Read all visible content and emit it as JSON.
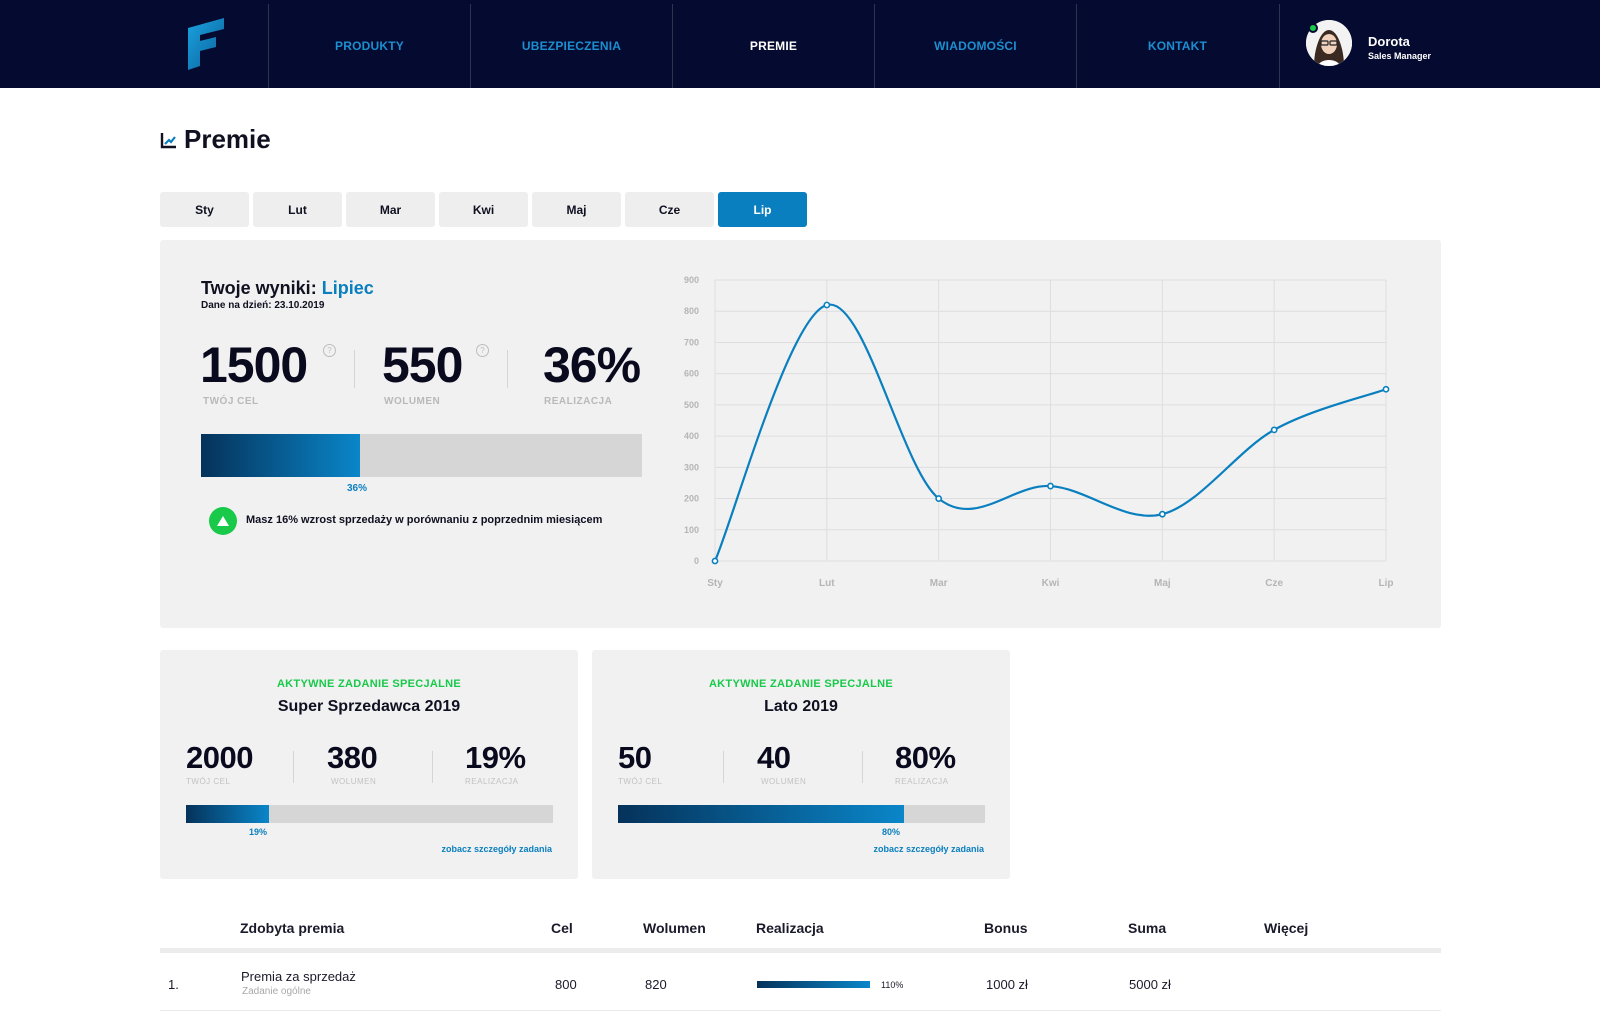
{
  "nav": {
    "items": [
      {
        "label": "PRODUKTY",
        "active": false
      },
      {
        "label": "UBEZPIECZENIA",
        "active": false
      },
      {
        "label": "PREMIE",
        "active": true
      },
      {
        "label": "WIADOMOŚCI",
        "active": false
      },
      {
        "label": "KONTAKT",
        "active": false
      }
    ],
    "user": {
      "name": "Dorota",
      "role": "Sales Manager",
      "online": true
    }
  },
  "page": {
    "title": "Premie",
    "icon": "chart-line-icon"
  },
  "months": {
    "tabs": [
      "Sty",
      "Lut",
      "Mar",
      "Kwi",
      "Maj",
      "Cze",
      "Lip"
    ],
    "selected": "Lip"
  },
  "results": {
    "title_prefix": "Twoje wyniki:",
    "month": "Lipiec",
    "date_text": "Dane na dzień: 23.10.2019",
    "target": {
      "value": "1500",
      "label": "TWÓJ CEL"
    },
    "volume": {
      "value": "550",
      "label": "WOLUMEN"
    },
    "realization": {
      "value": "36%",
      "label": "REALIZACJA"
    },
    "progress_label": "36%",
    "progress_fraction": 0.36,
    "trend_text": "Masz 16% wzrost sprzedaży w porównaniu z poprzednim miesiącem",
    "trend_icon": "arrow-up-icon"
  },
  "chart_data": {
    "type": "line",
    "categories": [
      "Sty",
      "Lut",
      "Mar",
      "Kwi",
      "Maj",
      "Cze",
      "Lip"
    ],
    "series": [
      {
        "values": [
          0,
          820,
          200,
          240,
          150,
          420,
          550
        ]
      }
    ],
    "ylim": [
      0,
      900
    ],
    "yticks": [
      0,
      100,
      200,
      300,
      400,
      500,
      600,
      700,
      800,
      900
    ],
    "grid": true,
    "color": "#0a7fbf"
  },
  "tasks": [
    {
      "tag": "AKTYWNE ZADANIE SPECJALNE",
      "title": "Super Sprzedawca 2019",
      "target": {
        "value": "2000",
        "label": "TWÓJ CEL"
      },
      "volume": {
        "value": "380",
        "label": "WOLUMEN"
      },
      "realization": {
        "value": "19%",
        "label": "REALIZACJA"
      },
      "progress_label": "19%",
      "progress_fraction": 0.225,
      "link": "zobacz szczegóły zadania"
    },
    {
      "tag": "AKTYWNE ZADANIE SPECJALNE",
      "title": "Lato 2019",
      "target": {
        "value": "50",
        "label": "TWÓJ CEL"
      },
      "volume": {
        "value": "40",
        "label": "WOLUMEN"
      },
      "realization": {
        "value": "80%",
        "label": "REALIZACJA"
      },
      "progress_label": "80%",
      "progress_fraction": 0.78,
      "link": "zobacz szczegóły zadania"
    }
  ],
  "table": {
    "columns": [
      "Zdobyta premia",
      "Cel",
      "Wolumen",
      "Realizacja",
      "Bonus",
      "Suma",
      "Więcej"
    ],
    "rows": [
      {
        "index": "1.",
        "name": "Premia za sprzedaż",
        "subtitle": "Zadanie ogólne",
        "target": "800",
        "volume": "820",
        "realization": "110%",
        "bonus": "1000 zł",
        "sum": "5000 zł"
      }
    ]
  },
  "colors": {
    "navbar": "#050a30",
    "accent": "#0a7fbf",
    "success": "#18c94a",
    "panel": "#f1f1f1"
  }
}
